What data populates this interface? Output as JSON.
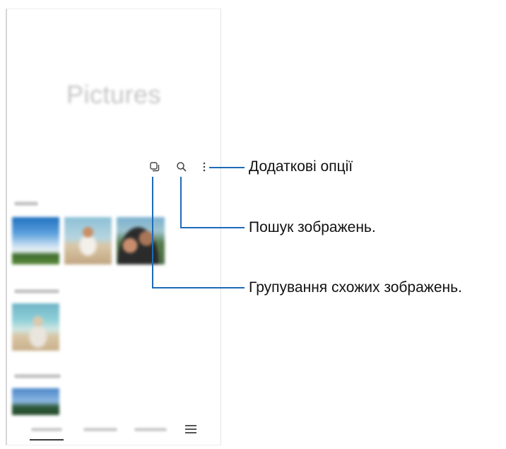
{
  "app": {
    "title": "Pictures"
  },
  "toolbar": {
    "similar_icon": "group-similar-icon",
    "search_icon": "search-icon",
    "more_icon": "more-options-icon"
  },
  "bottom_nav": {
    "menu_icon": "menu-icon"
  },
  "callouts": {
    "more_options": "Додаткові опції",
    "search": "Пошук зображень.",
    "group_similar": "Групування схожих зображень."
  },
  "colors": {
    "callout_line": "#1e6bb8"
  }
}
